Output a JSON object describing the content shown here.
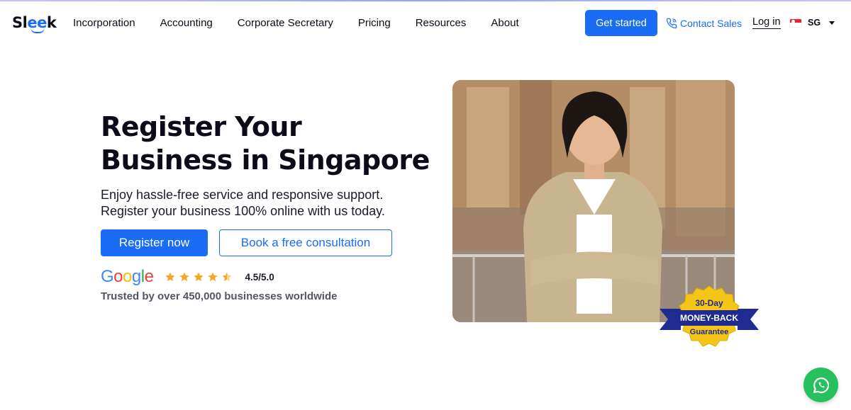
{
  "brand": {
    "logo_part1": "Sl",
    "logo_part2": "ee",
    "logo_part3": "k"
  },
  "nav": {
    "items": [
      "Incorporation",
      "Accounting",
      "Corporate Secretary",
      "Pricing",
      "Resources",
      "About"
    ],
    "get_started": "Get started",
    "contact_sales": "Contact Sales",
    "login": "Log in",
    "region": "SG"
  },
  "hero": {
    "headline_line1": "Register Your",
    "headline_line2": "Business in Singapore",
    "sub_line1": "Enjoy hassle-free service and responsive support.",
    "sub_line2": "Register your business 100% online with us today.",
    "primary_cta": "Register now",
    "secondary_cta": "Book a free consultation"
  },
  "rating": {
    "provider": "Google",
    "score": "4.5/5.0",
    "stars": 4.5,
    "trusted": "Trusted by over 450,000 businesses worldwide"
  },
  "badge": {
    "line1": "30-Day",
    "line2": "MONEY-BACK",
    "line3": "Guarantee"
  },
  "icons": [
    "phone-icon",
    "chevron-down-icon",
    "star-icon",
    "whatsapp-icon"
  ],
  "colors": {
    "accent": "#1a6cf5",
    "whatsapp": "#27c05f",
    "badge_gold": "#f5c518",
    "badge_navy": "#1f2b8f"
  }
}
